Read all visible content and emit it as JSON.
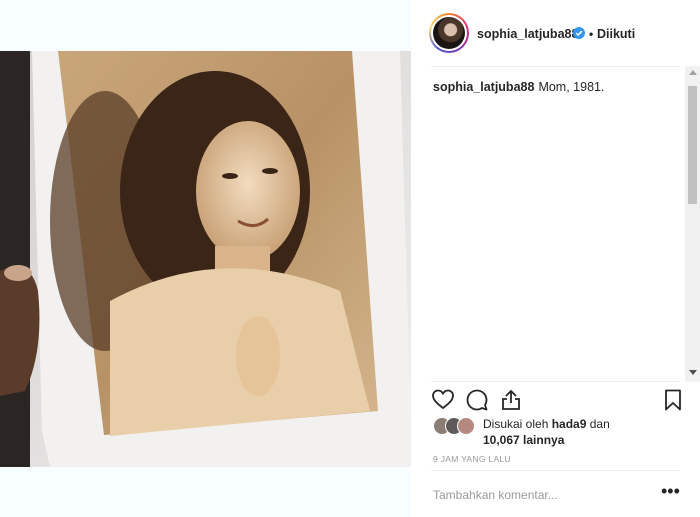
{
  "post": {
    "username": "sophia_latjuba88",
    "follow_status": "Diikuti",
    "separator": "•",
    "caption_text": "Mom, 1981.",
    "likes_prefix": "Disukai oleh",
    "likes_user": "hada9",
    "likes_and": "dan",
    "likes_count": "10,067 lainnya",
    "timestamp": "9 JAM YANG LALU"
  },
  "comment": {
    "placeholder": "Tambahkan komentar...",
    "more_label": "•••"
  },
  "icons": {
    "verified": "verified-badge-icon",
    "like": "heart-icon",
    "comment": "comment-bubble-icon",
    "share": "share-icon",
    "save": "bookmark-icon",
    "more": "more-options-icon"
  },
  "colors": {
    "verified_blue": "#3897f0",
    "text": "#262626",
    "muted": "#999999",
    "divider": "#efefef"
  }
}
